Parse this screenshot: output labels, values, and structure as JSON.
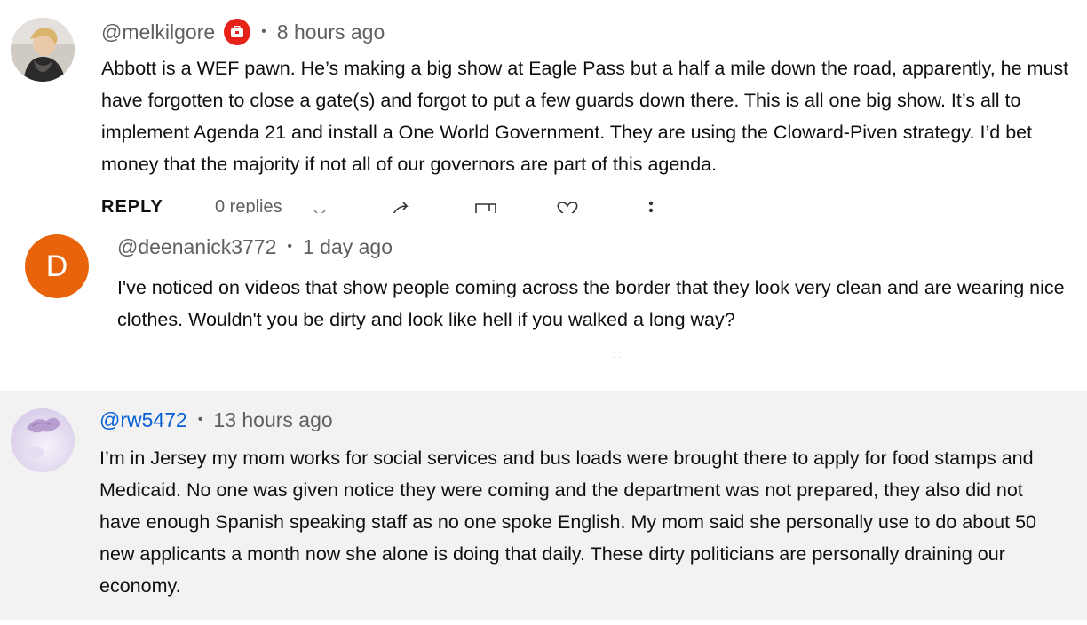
{
  "comments": [
    {
      "handle": "@melkilgore",
      "badge_icon": "creator-badge-icon",
      "badge_color": "#e62117",
      "separator": "•",
      "time": "8 hours ago",
      "text": "Abbott is a WEF pawn. He’s making a big show at Eagle Pass but a half a mile down the road, apparently, he must have forgotten to close a gate(s) and forgot to put a few guards down there. This is all one big show. It’s all to implement Agenda 21 and install a One World Government. They are using the Cloward-Piven strategy. I’d bet money that the majority if not all of our governors are part of this agenda.",
      "actions": {
        "reply_label": "REPLY",
        "replies_label": "0 replies",
        "icons": [
          "chevron-down-icon",
          "share-icon",
          "save-icon",
          "heart-icon",
          "more-vert-icon"
        ]
      }
    },
    {
      "handle": "@deenanick3772",
      "avatar_letter": "D",
      "avatar_color": "#e8630a",
      "separator": "•",
      "time": "1 day ago",
      "text": "I've noticed on videos that show people coming across the border that they look very clean and are wearing nice clothes. Wouldn't you be dirty and look like hell if you walked a long way?"
    },
    {
      "handle": "@rw5472",
      "handle_color": "#065fd4",
      "separator": "•",
      "time": "13 hours ago",
      "text": "I’m in Jersey my mom works for social services and bus loads were brought there to apply for food stamps and Medicaid. No one was given notice they were coming and the department was not prepared, they also did not have enough Spanish speaking staff as no one spoke English. My mom said she personally use to do about 50 new applicants a month now she alone is doing that daily. These dirty politicians are personally draining our economy."
    }
  ]
}
